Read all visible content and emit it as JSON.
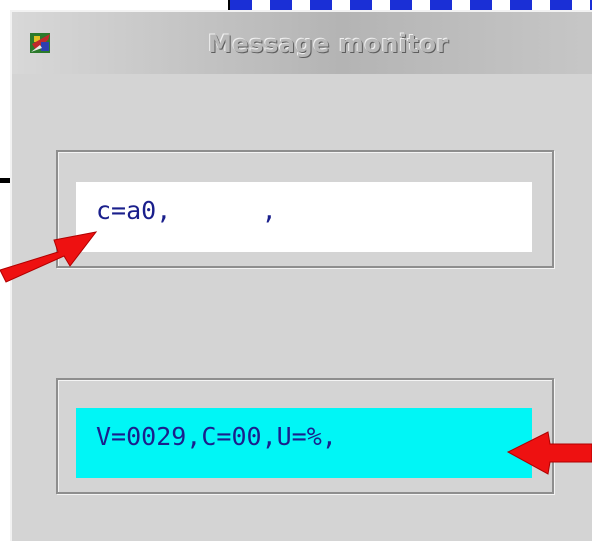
{
  "window": {
    "title": "Message monitor",
    "icon": "app-icon"
  },
  "fields": {
    "top_field_value": "c=a0,      ,",
    "bottom_field_value": "V=0029,C=00,U=%,"
  },
  "colors": {
    "window_bg": "#d4d4d4",
    "top_field_bg": "#ffffff",
    "bottom_field_bg": "#00f6f6",
    "field_text": "#1a1f8c",
    "arrow": "#ee1111"
  },
  "annotations": {
    "arrows": [
      "arrow-icon",
      "arrow-icon"
    ]
  }
}
